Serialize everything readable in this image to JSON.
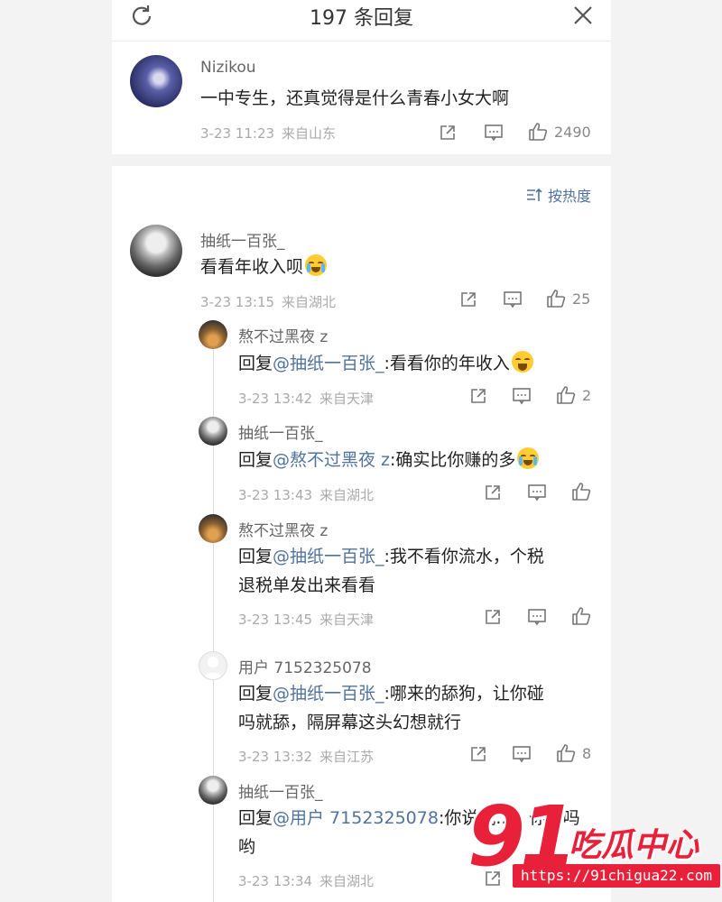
{
  "header": {
    "title": "197 条回复"
  },
  "sort": {
    "label": "按热度"
  },
  "main_comment": {
    "user": "Nizikou",
    "text": "一中专生，还真觉得是什么青春小女大啊",
    "time": "3-23 11:23",
    "location": "来自山东",
    "likes": "2490"
  },
  "comments": [
    {
      "user": "抽纸一百张_",
      "text": "看看年收入呗",
      "time": "3-23 13:15",
      "location": "来自湖北",
      "likes": "25"
    }
  ],
  "replies": [
    {
      "user": "熬不过黑夜 z",
      "prefix": "回复",
      "mention": "@抽纸一百张_",
      "text": ":看看你的年收入",
      "time": "3-23 13:42",
      "location": "来自天津",
      "likes": "2"
    },
    {
      "user": "抽纸一百张_",
      "prefix": "回复",
      "mention": "@熬不过黑夜 z",
      "text": ":确实比你赚的多",
      "time": "3-23 13:43",
      "location": "来自湖北",
      "likes": ""
    },
    {
      "user": "熬不过黑夜 z",
      "prefix": "回复",
      "mention": "@抽纸一百张_",
      "text": ":我不看你流水，个税",
      "text2": "退税单发出来看看",
      "time": "3-23 13:45",
      "location": "来自天津",
      "likes": ""
    },
    {
      "user": "用户 7152325078",
      "prefix": "回复",
      "mention": "@抽纸一百张_",
      "text": ":哪来的舔狗，让你碰",
      "text2": "吗就舔，隔屏幕这头幻想就行",
      "time": "3-23 13:32",
      "location": "来自江苏",
      "likes": "8"
    },
    {
      "user": "抽纸一百张_",
      "prefix": "回复",
      "mention": "@用户 7152325078",
      "text": ":你说我...，你...吗",
      "text2": "哟",
      "time": "3-23 13:34",
      "location": "来自湖北",
      "likes": ""
    }
  ],
  "watermark": {
    "brand_num": "91",
    "brand_name": "吃瓜中心",
    "url": "https://91chigua22.com"
  },
  "colors": {
    "mention": "#50739e",
    "watermark": "#e8203a"
  }
}
